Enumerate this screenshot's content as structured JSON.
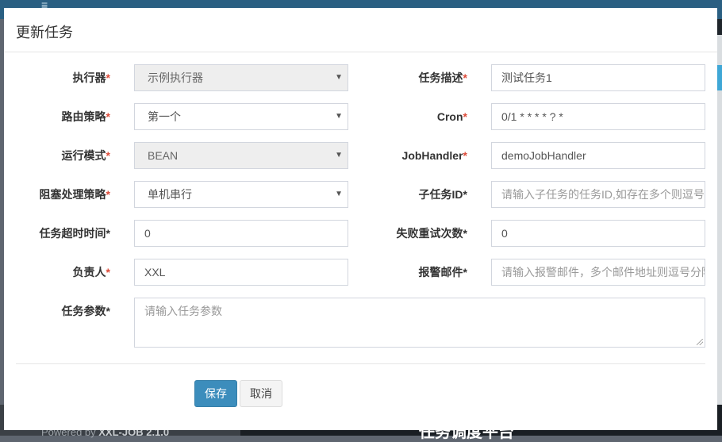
{
  "background": {
    "menu_icon": "≡",
    "footer_prefix": "Powered by ",
    "footer_brand": "XXL-JOB 2.1.0",
    "banner_text": "任务调度平台"
  },
  "modal": {
    "title": "更新任务",
    "required_mark": "*",
    "left": [
      {
        "label": "执行器",
        "required": true,
        "kind": "select",
        "value": "示例执行器",
        "disabled": true
      },
      {
        "label": "路由策略",
        "required": true,
        "kind": "select",
        "value": "第一个",
        "disabled": false
      },
      {
        "label": "运行模式",
        "required": true,
        "kind": "select",
        "value": "BEAN",
        "disabled": true
      },
      {
        "label": "阻塞处理策略",
        "required": true,
        "kind": "select",
        "value": "单机串行",
        "disabled": false
      },
      {
        "label": "任务超时时间*",
        "required": false,
        "kind": "input",
        "value": "0"
      },
      {
        "label": "负责人",
        "required": true,
        "kind": "input",
        "value": "XXL"
      }
    ],
    "right": [
      {
        "label": "任务描述",
        "required": true,
        "value": "测试任务1",
        "placeholder": ""
      },
      {
        "label": "Cron",
        "required": true,
        "value": "0/1 * * * * ? *",
        "placeholder": ""
      },
      {
        "label": "JobHandler",
        "required": true,
        "value": "demoJobHandler",
        "placeholder": ""
      },
      {
        "label": "子任务ID*",
        "required": false,
        "value": "",
        "placeholder": "请输入子任务的任务ID,如存在多个则逗号分隔"
      },
      {
        "label": "失败重试次数*",
        "required": false,
        "value": "0",
        "placeholder": ""
      },
      {
        "label": "报警邮件*",
        "required": false,
        "value": "",
        "placeholder": "请输入报警邮件，多个邮件地址则逗号分隔"
      }
    ],
    "params": {
      "label": "任务参数*",
      "placeholder": "请输入任务参数"
    },
    "save_label": "保存",
    "cancel_label": "取消",
    "caret_icon": "▼"
  }
}
